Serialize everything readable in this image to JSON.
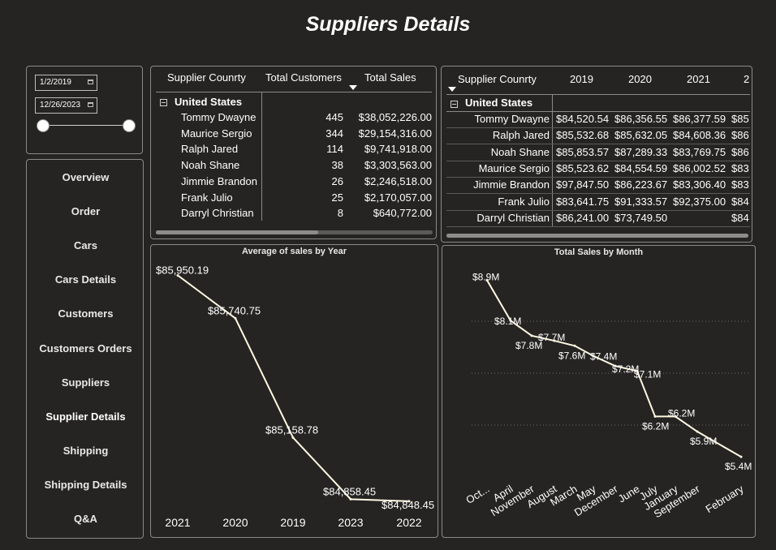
{
  "page": {
    "title": "Suppliers Details"
  },
  "slicer": {
    "start_date": "1/2/2019",
    "end_date": "12/26/2023"
  },
  "nav": [
    "Overview",
    "Order",
    "Cars",
    "Cars Details",
    "Customers",
    "Customers Orders",
    "Suppliers",
    "Supplier Details",
    "Shipping",
    "Shipping Details",
    "Q&A"
  ],
  "nav_active": "Supplier Details",
  "table1": {
    "headers": [
      "Supplier Counrty",
      "Total Customers",
      "Total Sales"
    ],
    "group": "United States",
    "rows": [
      {
        "name": "Tommy Dwayne",
        "customers": "445",
        "sales": "$38,052,226.00"
      },
      {
        "name": "Maurice Sergio",
        "customers": "344",
        "sales": "$29,154,316.00"
      },
      {
        "name": "Ralph Jared",
        "customers": "114",
        "sales": "$9,741,918.00"
      },
      {
        "name": "Noah Shane",
        "customers": "38",
        "sales": "$3,303,563.00"
      },
      {
        "name": "Jimmie Brandon",
        "customers": "26",
        "sales": "$2,246,518.00"
      },
      {
        "name": "Frank Julio",
        "customers": "25",
        "sales": "$2,170,057.00"
      },
      {
        "name": "Darryl Christian",
        "customers": "8",
        "sales": "$640,772.00"
      }
    ]
  },
  "table2": {
    "headers": [
      "Supplier Counrty",
      "2019",
      "2020",
      "2021",
      "2"
    ],
    "group": "United States",
    "rows": [
      {
        "name": "Tommy Dwayne",
        "v": [
          "$84,520.54",
          "$86,356.55",
          "$86,377.59",
          "$85"
        ]
      },
      {
        "name": "Ralph Jared",
        "v": [
          "$85,532.68",
          "$85,632.05",
          "$84,608.36",
          "$86"
        ]
      },
      {
        "name": "Noah Shane",
        "v": [
          "$85,853.57",
          "$87,289.33",
          "$83,769.75",
          "$86"
        ]
      },
      {
        "name": "Maurice Sergio",
        "v": [
          "$85,523.62",
          "$84,554.59",
          "$86,002.52",
          "$83"
        ]
      },
      {
        "name": "Jimmie Brandon",
        "v": [
          "$97,847.50",
          "$86,223.67",
          "$83,306.40",
          "$83"
        ]
      },
      {
        "name": "Frank Julio",
        "v": [
          "$83,641.75",
          "$91,333.57",
          "$92,375.00",
          "$84"
        ]
      },
      {
        "name": "Darryl Christian",
        "v": [
          "$86,241.00",
          "$73,749.50",
          "",
          "$84"
        ]
      }
    ]
  },
  "chart_data": [
    {
      "type": "line",
      "title": "Average of sales by Year",
      "categories": [
        "2021",
        "2020",
        "2019",
        "2023",
        "2022"
      ],
      "values": [
        85950.19,
        85740.75,
        85158.78,
        84858.45,
        84848.45
      ],
      "labels": [
        "$85,950.19",
        "$85,740.75",
        "$85,158.78",
        "$84,858.45",
        "$84,848.45"
      ],
      "color": "#fff8e1"
    },
    {
      "type": "line",
      "title": "Total Sales by Month",
      "categories": [
        "Oct...",
        "April",
        "November",
        "August",
        "March",
        "May",
        "December",
        "June",
        "July",
        "January",
        "September",
        "February"
      ],
      "values": [
        8.9,
        8.1,
        7.8,
        7.7,
        7.6,
        7.4,
        7.2,
        7.1,
        6.2,
        6.2,
        5.9,
        5.4
      ],
      "labels": [
        "$8.9M",
        "$8.1M",
        "$7.8M",
        "$7.7M",
        "$7.6M",
        "$7.4M",
        "$7.2M",
        "$7.1M",
        "$6.2M",
        "$6.2M",
        "$5.9M",
        "$5.4M"
      ],
      "grid": true,
      "color": "#fff8e1"
    }
  ]
}
